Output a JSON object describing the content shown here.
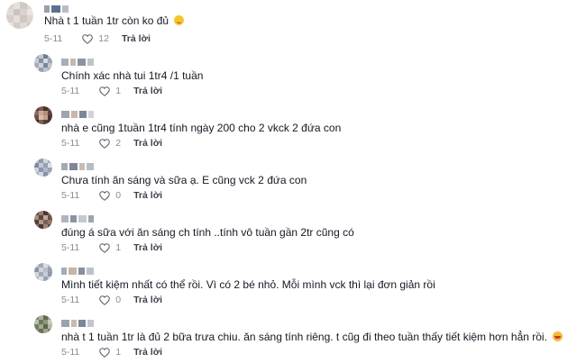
{
  "comments": [
    {
      "text": "Nhà t 1 tuần 1tr còn ko đủ",
      "emoji": "smile-emoji",
      "date": "5-11",
      "likes": "12",
      "reply": "Trả lời"
    },
    {
      "text": "Chính xác nhà tui 1tr4 /1 tuần",
      "date": "5-11",
      "likes": "1",
      "reply": "Trả lời"
    },
    {
      "text": "nhà e cũng 1tuần 1tr4 tính ngày 200 cho 2 vkck 2 đứa con",
      "date": "5-11",
      "likes": "2",
      "reply": "Trả lời"
    },
    {
      "text": "Chưa tính ăn sáng và sữa ạ. E cũng vck 2 đứa con",
      "date": "5-11",
      "likes": "0",
      "reply": "Trả lời"
    },
    {
      "text": "đúng á sữa với ăn sáng ch tính ..tính vô tuần gần 2tr cũng có",
      "date": "5-11",
      "likes": "1",
      "reply": "Trả lời"
    },
    {
      "text": "Mình tiết kiệm nhất có thể rồi. Vì có 2 bé nhỏ. Mỗi mình vck thì lại đơn giản rồi",
      "date": "5-11",
      "likes": "0",
      "reply": "Trả lời"
    },
    {
      "text": "nhà t 1 tuần 1tr là đủ 2 bữa trưa chiu. ăn sáng tính riêng. t cũg đi theo tuần thấy tiết kiệm hơn hẳn rồi.",
      "emoji": "laugh-emoji",
      "date": "5-11",
      "likes": "1",
      "reply": "Trả lời"
    }
  ],
  "colors": {
    "heart": "#5a5b63",
    "meta": "#8a8b91",
    "reply": "#3d3f4a"
  }
}
